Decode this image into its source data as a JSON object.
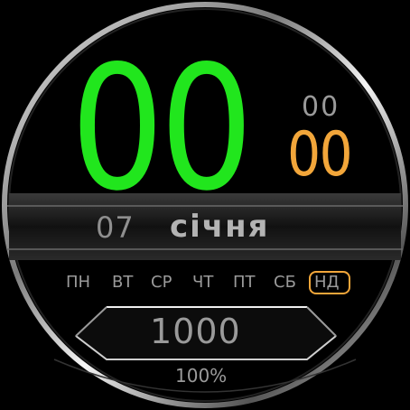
{
  "time": {
    "hours": "00",
    "minutes": "00",
    "seconds": "00"
  },
  "date": {
    "day": "07",
    "month": "січня"
  },
  "weekdays": {
    "items": [
      "ПН",
      "ВТ",
      "СР",
      "ЧТ",
      "ПТ",
      "СБ",
      "НД"
    ],
    "active_index": 6
  },
  "steps": "1000",
  "battery": "100%",
  "colors": {
    "hours": "#21e61d",
    "minutes": "#f2a63a",
    "accent": "#f2a63a",
    "text": "#9a9a9a"
  }
}
